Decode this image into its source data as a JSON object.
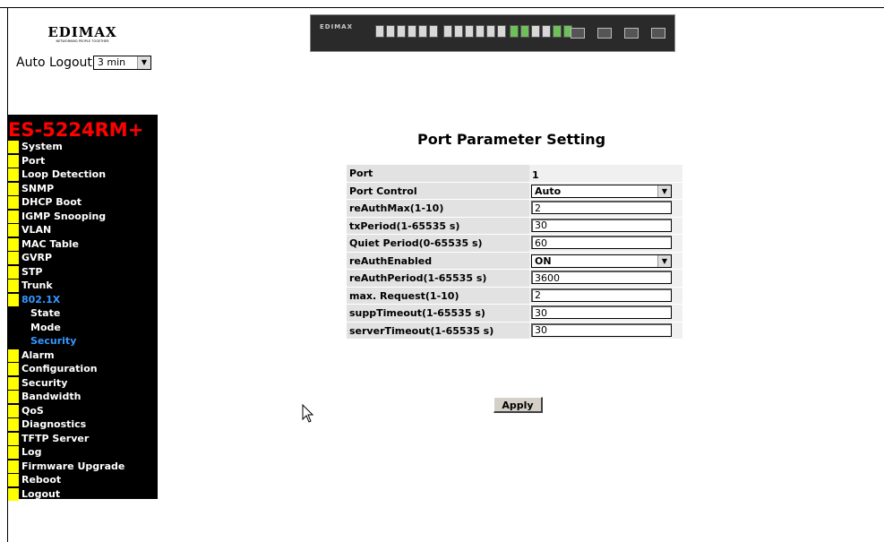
{
  "header": {
    "logo_text": "EDIMAX",
    "logo_tagline": "NETWORKING PEOPLE TOGETHER",
    "auto_logout_label": "Auto Logout",
    "auto_logout_value": "3 min",
    "device_brand": "EDIMAX"
  },
  "sidebar": {
    "model": "ES-5224RM+",
    "items": [
      {
        "label": "System"
      },
      {
        "label": "Port"
      },
      {
        "label": "Loop Detection"
      },
      {
        "label": "SNMP"
      },
      {
        "label": "DHCP Boot"
      },
      {
        "label": "IGMP Snooping"
      },
      {
        "label": "VLAN"
      },
      {
        "label": "MAC Table"
      },
      {
        "label": "GVRP"
      },
      {
        "label": "STP"
      },
      {
        "label": "Trunk"
      },
      {
        "label": "802.1X"
      },
      {
        "label": "State"
      },
      {
        "label": "Mode"
      },
      {
        "label": "Security"
      },
      {
        "label": "Alarm"
      },
      {
        "label": "Configuration"
      },
      {
        "label": "Security"
      },
      {
        "label": "Bandwidth"
      },
      {
        "label": "QoS"
      },
      {
        "label": "Diagnostics"
      },
      {
        "label": "TFTP Server"
      },
      {
        "label": "Log"
      },
      {
        "label": "Firmware Upgrade"
      },
      {
        "label": "Reboot"
      },
      {
        "label": "Logout"
      }
    ]
  },
  "main": {
    "title": "Port Parameter Setting",
    "rows": [
      {
        "label": "Port",
        "value": "1"
      },
      {
        "label": "Port Control",
        "value": "Auto"
      },
      {
        "label": "reAuthMax(1-10)",
        "value": "2"
      },
      {
        "label": "txPeriod(1-65535 s)",
        "value": "30"
      },
      {
        "label": "Quiet Period(0-65535 s)",
        "value": "60"
      },
      {
        "label": "reAuthEnabled",
        "value": "ON"
      },
      {
        "label": "reAuthPeriod(1-65535 s)",
        "value": "3600"
      },
      {
        "label": "max. Request(1-10)",
        "value": "2"
      },
      {
        "label": "suppTimeout(1-65535 s)",
        "value": "30"
      },
      {
        "label": "serverTimeout(1-65535 s)",
        "value": "30"
      }
    ],
    "apply_label": "Apply"
  }
}
